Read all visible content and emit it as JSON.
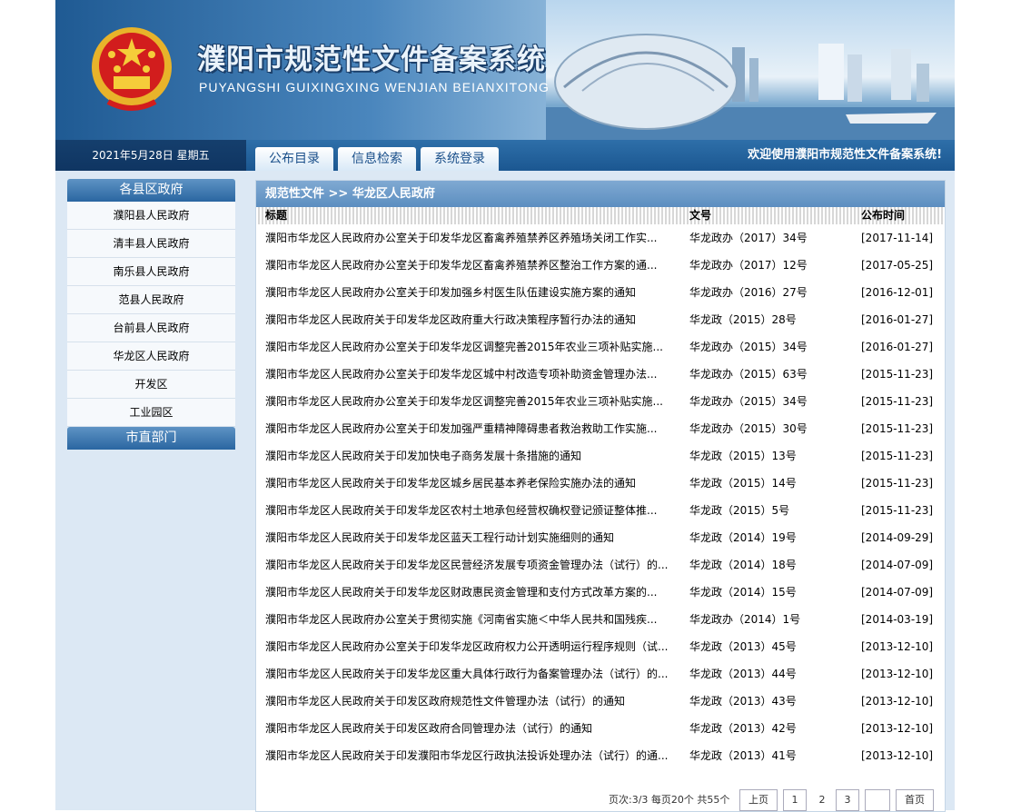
{
  "header": {
    "title": "濮阳市规范性文件备案系统",
    "subtitle": "PUYANGSHI GUIXINGXING WENJIAN BEIANXITONG"
  },
  "navbar": {
    "date": "2021年5月28日 星期五",
    "tabs": [
      {
        "label": "公布目录"
      },
      {
        "label": "信息检索"
      },
      {
        "label": "系统登录"
      }
    ],
    "welcome": "欢迎使用濮阳市规范性文件备案系统!"
  },
  "sidebar": {
    "section1": "各县区政府",
    "items": [
      {
        "label": "濮阳县人民政府"
      },
      {
        "label": "清丰县人民政府"
      },
      {
        "label": "南乐县人民政府"
      },
      {
        "label": "范县人民政府"
      },
      {
        "label": "台前县人民政府"
      },
      {
        "label": "华龙区人民政府"
      },
      {
        "label": "开发区"
      },
      {
        "label": "工业园区"
      }
    ],
    "section2": "市直部门"
  },
  "main": {
    "breadcrumb": "规范性文件 >> 华龙区人民政府",
    "columns": {
      "title": "标题",
      "doc_no": "文号",
      "date": "公布时间"
    },
    "rows": [
      {
        "title": "濮阳市华龙区人民政府办公室关于印发华龙区畜禽养殖禁养区养殖场关闭工作实...",
        "doc_no": "华龙政办（2017）34号",
        "date": "[2017-11-14]"
      },
      {
        "title": "濮阳市华龙区人民政府办公室关于印发华龙区畜禽养殖禁养区整治工作方案的通...",
        "doc_no": "华龙政办（2017）12号",
        "date": "[2017-05-25]"
      },
      {
        "title": "濮阳市华龙区人民政府办公室关于印发加强乡村医生队伍建设实施方案的通知",
        "doc_no": "华龙政办（2016）27号",
        "date": "[2016-12-01]"
      },
      {
        "title": "濮阳市华龙区人民政府关于印发华龙区政府重大行政决策程序暂行办法的通知",
        "doc_no": "华龙政（2015）28号",
        "date": "[2016-01-27]"
      },
      {
        "title": "濮阳市华龙区人民政府办公室关于印发华龙区调整完善2015年农业三项补贴实施...",
        "doc_no": "华龙政办（2015）34号",
        "date": "[2016-01-27]"
      },
      {
        "title": "濮阳市华龙区人民政府办公室关于印发华龙区城中村改造专项补助资金管理办法...",
        "doc_no": "华龙政办（2015）63号",
        "date": "[2015-11-23]"
      },
      {
        "title": "濮阳市华龙区人民政府办公室关于印发华龙区调整完善2015年农业三项补贴实施...",
        "doc_no": "华龙政办（2015）34号",
        "date": "[2015-11-23]"
      },
      {
        "title": "濮阳市华龙区人民政府办公室关于印发加强严重精神障碍患者救治救助工作实施...",
        "doc_no": "华龙政办（2015）30号",
        "date": "[2015-11-23]"
      },
      {
        "title": "濮阳市华龙区人民政府关于印发加快电子商务发展十条措施的通知",
        "doc_no": "华龙政（2015）13号",
        "date": "[2015-11-23]"
      },
      {
        "title": "濮阳市华龙区人民政府关于印发华龙区城乡居民基本养老保险实施办法的通知",
        "doc_no": "华龙政（2015）14号",
        "date": "[2015-11-23]"
      },
      {
        "title": "濮阳市华龙区人民政府关于印发华龙区农村土地承包经营权确权登记颁证整体推...",
        "doc_no": "华龙政（2015）5号",
        "date": "[2015-11-23]"
      },
      {
        "title": "濮阳市华龙区人民政府关于印发华龙区蓝天工程行动计划实施细则的通知",
        "doc_no": "华龙政（2014）19号",
        "date": "[2014-09-29]"
      },
      {
        "title": "濮阳市华龙区人民政府关于印发华龙区民营经济发展专项资金管理办法（试行）的...",
        "doc_no": "华龙政（2014）18号",
        "date": "[2014-07-09]"
      },
      {
        "title": "濮阳市华龙区人民政府关于印发华龙区财政惠民资金管理和支付方式改革方案的...",
        "doc_no": "华龙政（2014）15号",
        "date": "[2014-07-09]"
      },
      {
        "title": "濮阳市华龙区人民政府办公室关于贯彻实施《河南省实施＜中华人民共和国残疾...",
        "doc_no": "华龙政办（2014）1号",
        "date": "[2014-03-19]"
      },
      {
        "title": "濮阳市华龙区人民政府办公室关于印发华龙区政府权力公开透明运行程序规则（试...",
        "doc_no": "华龙政（2013）45号",
        "date": "[2013-12-10]"
      },
      {
        "title": "濮阳市华龙区人民政府关于印发华龙区重大具体行政行为备案管理办法（试行）的...",
        "doc_no": "华龙政（2013）44号",
        "date": "[2013-12-10]"
      },
      {
        "title": "濮阳市华龙区人民政府关于印发区政府规范性文件管理办法（试行）的通知",
        "doc_no": "华龙政（2013）43号",
        "date": "[2013-12-10]"
      },
      {
        "title": "濮阳市华龙区人民政府关于印发区政府合同管理办法（试行）的通知",
        "doc_no": "华龙政（2013）42号",
        "date": "[2013-12-10]"
      },
      {
        "title": "濮阳市华龙区人民政府关于印发濮阳市华龙区行政执法投诉处理办法（试行）的通...",
        "doc_no": "华龙政（2013）41号",
        "date": "[2013-12-10]"
      }
    ]
  },
  "pager": {
    "info": "页次:3/3 每页20个 共55个",
    "prev": "上页",
    "pages": [
      "1",
      "2",
      "3"
    ],
    "blank": "",
    "first": "首页"
  }
}
